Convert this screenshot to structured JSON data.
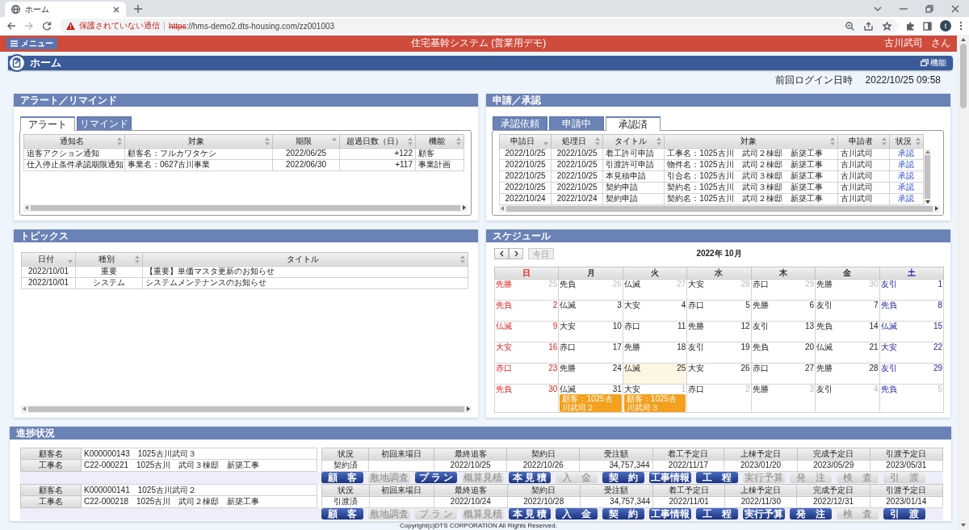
{
  "browser": {
    "tab_title": "ホーム",
    "security_label": "保護されていない通信",
    "url_scheme": "https",
    "url_rest": "://hms-demo2.dts-housing.com/zz001003",
    "avatar": "t"
  },
  "app": {
    "menu": "メニュー",
    "title": "住宅基幹システム (営業用デモ)",
    "user": "古川武司",
    "honorific": "さん"
  },
  "page": {
    "title": "ホーム",
    "function_button": "機能",
    "last_login_label": "前回ログイン日時",
    "last_login": "2022/10/25 09:58"
  },
  "alerts": {
    "title": "アラート／リマインド",
    "tabs": [
      {
        "label": "アラート",
        "selected": true
      },
      {
        "label": "リマインド",
        "selected": false
      }
    ],
    "columns": [
      {
        "label": "通知名",
        "sorted": false
      },
      {
        "label": "対象",
        "sorted": false
      },
      {
        "label": "期限",
        "sorted": true,
        "descending": false
      },
      {
        "label": "超過日数（日）",
        "sorted": false
      },
      {
        "label": "機能",
        "sorted": false
      }
    ],
    "rows": [
      [
        "追客アクション通知",
        "顧客名：フルカワタケシ",
        "2022/06/25",
        "+122",
        "顧客"
      ],
      [
        "仕入停止条件承認期限通知",
        "事業名：0627古川事業",
        "2022/06/30",
        "+117",
        "事業計画"
      ]
    ]
  },
  "approvals": {
    "title": "申請／承認",
    "tabs": [
      {
        "label": "承認依頼",
        "selected": false
      },
      {
        "label": "申請中",
        "selected": false
      },
      {
        "label": "承認済",
        "selected": true
      }
    ],
    "columns": [
      {
        "label": "申請日",
        "sorted": true,
        "descending": true
      },
      {
        "label": "処理日",
        "sorted": false
      },
      {
        "label": "タイトル",
        "sorted": false
      },
      {
        "label": "対象",
        "sorted": false
      },
      {
        "label": "申請者",
        "sorted": false
      },
      {
        "label": "状況",
        "sorted": false
      }
    ],
    "rows": [
      {
        "cells": [
          "2022/10/25",
          "2022/10/25",
          "着工許可申請",
          "工事名：1025古川　武司２棟邸　新築工事",
          "古川武司"
        ],
        "status": "承認"
      },
      {
        "cells": [
          "2022/10/25",
          "2022/10/25",
          "引渡許可申請",
          "物件名：1025古川　武司２棟邸　新築工事",
          "古川武司"
        ],
        "status": "承認"
      },
      {
        "cells": [
          "2022/10/25",
          "2022/10/25",
          "本見積申請",
          "引合名：1025古川　武司３棟邸　新築工事",
          "古川武司"
        ],
        "status": "承認"
      },
      {
        "cells": [
          "2022/10/25",
          "2022/10/25",
          "契約申請",
          "契約名：1025古川　武司３棟邸　新築工事",
          "古川武司"
        ],
        "status": "承認"
      },
      {
        "cells": [
          "2022/10/24",
          "2022/10/24",
          "契約申請",
          "契約名：1025古川　武司２棟邸　新築工事",
          "古川武司"
        ],
        "status": "承認"
      }
    ]
  },
  "topics": {
    "title": "トピックス",
    "columns": [
      {
        "label": "日付",
        "sorted": true,
        "descending": true
      },
      {
        "label": "種別",
        "sorted": false
      },
      {
        "label": "タイトル",
        "sorted": false
      }
    ],
    "rows": [
      [
        "2022/10/01",
        "重要",
        "【重要】単価マスタ更新のお知らせ"
      ],
      [
        "2022/10/01",
        "システム",
        "システムメンテナンスのお知らせ"
      ]
    ]
  },
  "schedule": {
    "title": "スケジュール",
    "today_button": {
      "label": "今日",
      "disabled": true
    },
    "month": "2022年 10月",
    "weekdays": [
      "日",
      "月",
      "火",
      "水",
      "木",
      "金",
      "土"
    ],
    "weeks": [
      [
        {
          "rokuyo": "先勝",
          "day": "25",
          "other_month": true,
          "today": false
        },
        {
          "rokuyo": "先負",
          "day": "26",
          "other_month": true,
          "today": false
        },
        {
          "rokuyo": "仏滅",
          "day": "27",
          "other_month": true,
          "today": false
        },
        {
          "rokuyo": "大安",
          "day": "28",
          "other_month": true,
          "today": false
        },
        {
          "rokuyo": "赤口",
          "day": "29",
          "other_month": true,
          "today": false
        },
        {
          "rokuyo": "先勝",
          "day": "30",
          "other_month": true,
          "today": false
        },
        {
          "rokuyo": "友引",
          "day": "1",
          "other_month": false,
          "today": false
        }
      ],
      [
        {
          "rokuyo": "先負",
          "day": "2",
          "other_month": false,
          "today": false
        },
        {
          "rokuyo": "仏滅",
          "day": "3",
          "other_month": false,
          "today": false
        },
        {
          "rokuyo": "大安",
          "day": "4",
          "other_month": false,
          "today": false
        },
        {
          "rokuyo": "赤口",
          "day": "5",
          "other_month": false,
          "today": false
        },
        {
          "rokuyo": "先勝",
          "day": "6",
          "other_month": false,
          "today": false
        },
        {
          "rokuyo": "友引",
          "day": "7",
          "other_month": false,
          "today": false
        },
        {
          "rokuyo": "先負",
          "day": "8",
          "other_month": false,
          "today": false
        }
      ],
      [
        {
          "rokuyo": "仏滅",
          "day": "9",
          "other_month": false,
          "today": false
        },
        {
          "rokuyo": "大安",
          "day": "10",
          "other_month": false,
          "today": false
        },
        {
          "rokuyo": "赤口",
          "day": "11",
          "other_month": false,
          "today": false
        },
        {
          "rokuyo": "先勝",
          "day": "12",
          "other_month": false,
          "today": false
        },
        {
          "rokuyo": "友引",
          "day": "13",
          "other_month": false,
          "today": false
        },
        {
          "rokuyo": "先負",
          "day": "14",
          "other_month": false,
          "today": false
        },
        {
          "rokuyo": "仏滅",
          "day": "15",
          "other_month": false,
          "today": false
        }
      ],
      [
        {
          "rokuyo": "大安",
          "day": "16",
          "other_month": false,
          "today": false
        },
        {
          "rokuyo": "赤口",
          "day": "17",
          "other_month": false,
          "today": false
        },
        {
          "rokuyo": "先勝",
          "day": "18",
          "other_month": false,
          "today": false
        },
        {
          "rokuyo": "友引",
          "day": "19",
          "other_month": false,
          "today": false
        },
        {
          "rokuyo": "先負",
          "day": "20",
          "other_month": false,
          "today": false
        },
        {
          "rokuyo": "仏滅",
          "day": "21",
          "other_month": false,
          "today": false
        },
        {
          "rokuyo": "大安",
          "day": "22",
          "other_month": false,
          "today": false
        }
      ],
      [
        {
          "rokuyo": "赤口",
          "day": "23",
          "other_month": false,
          "today": false
        },
        {
          "rokuyo": "先勝",
          "day": "24",
          "other_month": false,
          "today": false
        },
        {
          "rokuyo": "仏滅",
          "day": "25",
          "other_month": false,
          "today": true
        },
        {
          "rokuyo": "大安",
          "day": "26",
          "other_month": false,
          "today": false
        },
        {
          "rokuyo": "赤口",
          "day": "27",
          "other_month": false,
          "today": false
        },
        {
          "rokuyo": "先勝",
          "day": "28",
          "other_month": false,
          "today": false
        },
        {
          "rokuyo": "友引",
          "day": "29",
          "other_month": false,
          "today": false
        }
      ],
      [
        {
          "rokuyo": "先負",
          "day": "30",
          "other_month": false,
          "today": false
        },
        {
          "rokuyo": "仏滅",
          "day": "31",
          "other_month": false,
          "today": false,
          "events": [
            "顧客：1025古川武司２"
          ]
        },
        {
          "rokuyo": "大安",
          "day": "1",
          "other_month": true,
          "today": false,
          "events": [
            "顧客：1025古川武司３"
          ]
        },
        {
          "rokuyo": "赤口",
          "day": "2",
          "other_month": true,
          "today": false
        },
        {
          "rokuyo": "先勝",
          "day": "3",
          "other_month": true,
          "today": false
        },
        {
          "rokuyo": "友引",
          "day": "4",
          "other_month": true,
          "today": false
        },
        {
          "rokuyo": "先負",
          "day": "5",
          "other_month": true,
          "today": false
        }
      ]
    ]
  },
  "progress": {
    "title": "進捗状況",
    "entries": [
      {
        "customer_label": "顧客名",
        "customer": "K000000143　1025古川武司３",
        "project_label": "工事名",
        "project": "C22-000221　1025古川　武司３棟邸　新築工事",
        "fields": [
          {
            "label": "状況",
            "value": "契約済"
          },
          {
            "label": "初回来場日"
          },
          {
            "label": "最終追客",
            "value": "2022/10/25"
          },
          {
            "label": "契約日",
            "value": "2022/10/26"
          },
          {
            "label": "受注額",
            "value": "34,757,344"
          },
          {
            "label": "着工予定日",
            "value": "2022/11/17"
          },
          {
            "label": "上棟予定日",
            "value": "2023/01/20"
          },
          {
            "label": "完成予定日",
            "value": "2023/05/29"
          },
          {
            "label": "引渡予定日",
            "value": "2023/05/31"
          }
        ],
        "buttons": [
          {
            "label": "顧　客",
            "disabled": false
          },
          {
            "label": "敷地調査",
            "disabled": true
          },
          {
            "label": "プ ラ ン",
            "disabled": false
          },
          {
            "label": "概算見積",
            "disabled": true
          },
          {
            "label": "本 見 積",
            "disabled": false
          },
          {
            "label": "入　金",
            "disabled": true
          },
          {
            "label": "契　約",
            "disabled": false
          },
          {
            "label": "工事情報",
            "disabled": false
          },
          {
            "label": "工　程",
            "disabled": false
          },
          {
            "label": "実行予算",
            "disabled": true
          },
          {
            "label": "発　注",
            "disabled": true
          },
          {
            "label": "検　査",
            "disabled": true
          },
          {
            "label": "引　渡",
            "disabled": true
          }
        ]
      },
      {
        "customer_label": "顧客名",
        "customer": "K000000141　1025古川武司２",
        "project_label": "工事名",
        "project": "C22-000218　1025古川　武司２棟邸　新築工事",
        "fields": [
          {
            "label": "状況",
            "value": "引渡済"
          },
          {
            "label": "初回来場日"
          },
          {
            "label": "最終追客",
            "value": "2022/10/24"
          },
          {
            "label": "契約日",
            "value": "2022/10/28"
          },
          {
            "label": "受注額",
            "value": "34,757,344"
          },
          {
            "label": "着工予定日",
            "value": "2022/11/01"
          },
          {
            "label": "上棟予定日",
            "value": "2022/11/30"
          },
          {
            "label": "完成予定日",
            "value": "2022/12/31"
          },
          {
            "label": "引渡予定日",
            "value": "2023/01/14"
          }
        ],
        "buttons": [
          {
            "label": "顧　客",
            "disabled": false
          },
          {
            "label": "敷地調査",
            "disabled": true
          },
          {
            "label": "プ ラ ン",
            "disabled": true
          },
          {
            "label": "概算見積",
            "disabled": true
          },
          {
            "label": "本 見 積",
            "disabled": false
          },
          {
            "label": "入　金",
            "disabled": false
          },
          {
            "label": "契　約",
            "disabled": false
          },
          {
            "label": "工事情報",
            "disabled": false
          },
          {
            "label": "工　程",
            "disabled": false
          },
          {
            "label": "実行予算",
            "disabled": false
          },
          {
            "label": "発　注",
            "disabled": false
          },
          {
            "label": "検　査",
            "disabled": true
          },
          {
            "label": "引　渡",
            "disabled": false
          }
        ]
      }
    ]
  },
  "footer": "Copyright(c)DTS CORPORATION All Rights Reserved."
}
